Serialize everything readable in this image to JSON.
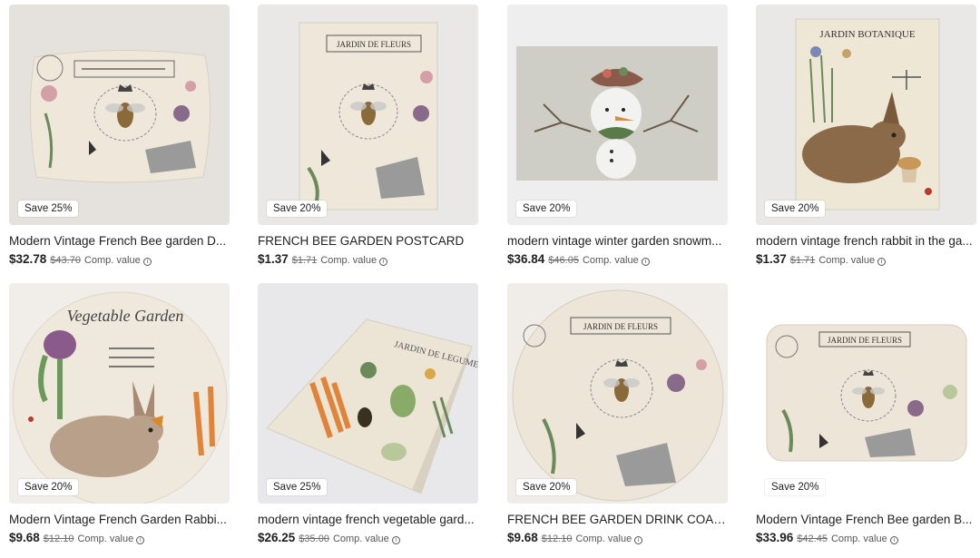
{
  "products": [
    {
      "title": "Modern Vintage French Bee garden D...",
      "price": "$32.78",
      "original": "$43.70",
      "comp": "Comp. value",
      "badge": "Save 25%",
      "image": "bee-pillow"
    },
    {
      "title": "FRENCH BEE GARDEN POSTCARD",
      "price": "$1.37",
      "original": "$1.71",
      "comp": "Comp. value",
      "badge": "Save 20%",
      "image": "bee-postcard",
      "image_text": "JARDIN DE FLEURS"
    },
    {
      "title": "modern vintage winter garden snowm...",
      "price": "$36.84",
      "original": "$46.05",
      "comp": "Comp. value",
      "badge": "Save 20%",
      "image": "snowman-placemat"
    },
    {
      "title": "modern vintage french rabbit in the ga...",
      "price": "$1.37",
      "original": "$1.71",
      "comp": "Comp. value",
      "badge": "Save 20%",
      "image": "rabbit-postcard",
      "image_text": "JARDIN BOTANIQUE"
    },
    {
      "title": "Modern Vintage French Garden Rabbi...",
      "price": "$9.68",
      "original": "$12.10",
      "comp": "Comp. value",
      "badge": "Save 20%",
      "image": "rabbit-plate",
      "image_text": "Vegetable Garden"
    },
    {
      "title": "modern vintage french vegetable gard...",
      "price": "$26.25",
      "original": "$35.00",
      "comp": "Comp. value",
      "badge": "Save 25%",
      "image": "vegetable-wrapping-paper",
      "image_text": "JARDIN DE LEGUMES"
    },
    {
      "title": "FRENCH BEE GARDEN DRINK COAST...",
      "price": "$9.68",
      "original": "$12.10",
      "comp": "Comp. value",
      "badge": "Save 20%",
      "image": "bee-coaster",
      "image_text": "JARDIN DE FLEURS"
    },
    {
      "title": "Modern Vintage French Bee garden B...",
      "price": "$33.96",
      "original": "$42.45",
      "comp": "Comp. value",
      "badge": "Save 20%",
      "image": "bee-bath-mat",
      "image_text": "JARDIN DE FLEURS"
    }
  ],
  "colors": {
    "tile_bg": "#ececea",
    "paper": "#efe9dd",
    "ink": "#3a3a3a"
  },
  "icons": {
    "info": "info-icon"
  }
}
